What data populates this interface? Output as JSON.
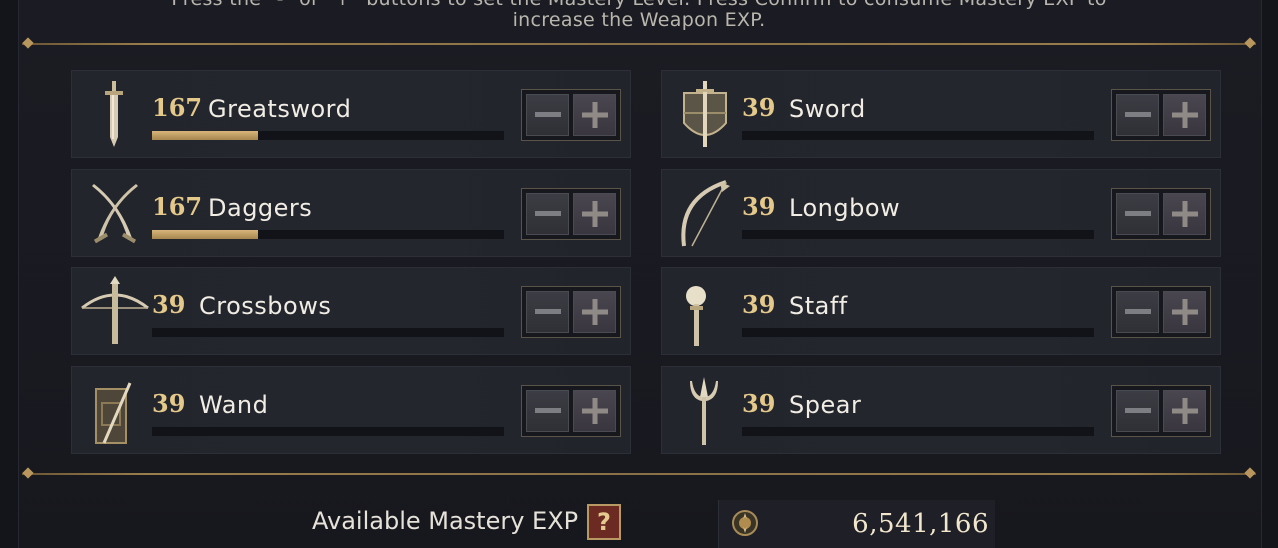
{
  "instructions": {
    "line1": "Press the \"-\" or \"+\" buttons to set the Mastery Level. Press Confirm to consume Mastery EXP to",
    "line2": "increase the Weapon EXP."
  },
  "weapons": [
    {
      "level": "167",
      "name": "Greatsword",
      "progress": 0.3,
      "icon": "greatsword-icon"
    },
    {
      "level": "39",
      "name": "Sword",
      "progress": 0,
      "icon": "sword-shield-icon"
    },
    {
      "level": "167",
      "name": "Daggers",
      "progress": 0.3,
      "icon": "daggers-icon"
    },
    {
      "level": "39",
      "name": "Longbow",
      "progress": 0,
      "icon": "longbow-icon"
    },
    {
      "level": "39",
      "name": "Crossbows",
      "progress": 0,
      "icon": "crossbow-icon"
    },
    {
      "level": "39",
      "name": "Staff",
      "progress": 0,
      "icon": "staff-icon"
    },
    {
      "level": "39",
      "name": "Wand",
      "progress": 0,
      "icon": "wand-tome-icon"
    },
    {
      "level": "39",
      "name": "Spear",
      "progress": 0,
      "icon": "spear-icon"
    }
  ],
  "buttons": {
    "minus": "−",
    "plus": "+"
  },
  "footer": {
    "label": "Available Mastery EXP",
    "help": "?",
    "amount": "6,541,166",
    "currency_icon": "mastery-exp-coin-icon"
  },
  "colors": {
    "accent_gold": "#e5c98b",
    "progress": "#c9a86b",
    "background": "#1b1c23"
  }
}
